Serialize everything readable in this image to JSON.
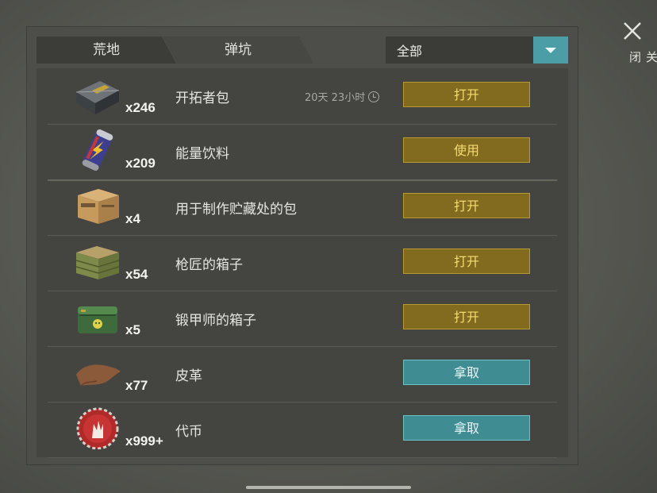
{
  "tabs": [
    {
      "label": "荒地"
    },
    {
      "label": "弹坑"
    }
  ],
  "filter": {
    "selected": "全部"
  },
  "close": {
    "label": "关闭"
  },
  "items": [
    {
      "name": "开拓者包",
      "count": "x246",
      "timer": "20天 23小时",
      "action": "打开",
      "action_style": "gold",
      "icon": "supply-crate-icon"
    },
    {
      "name": "能量饮料",
      "count": "x209",
      "timer": "",
      "action": "使用",
      "action_style": "gold",
      "icon": "energy-drink-icon"
    },
    {
      "name": "用于制作贮藏处的包",
      "count": "x4",
      "timer": "",
      "action": "打开",
      "action_style": "gold",
      "icon": "cardboard-box-icon"
    },
    {
      "name": "枪匠的箱子",
      "count": "x54",
      "timer": "",
      "action": "打开",
      "action_style": "gold",
      "icon": "wooden-crate-icon"
    },
    {
      "name": "锻甲师的箱子",
      "count": "x5",
      "timer": "",
      "action": "打开",
      "action_style": "gold",
      "icon": "military-chest-icon"
    },
    {
      "name": "皮革",
      "count": "x77",
      "timer": "",
      "action": "拿取",
      "action_style": "teal",
      "icon": "leather-icon"
    },
    {
      "name": "代币",
      "count": "x999+",
      "timer": "",
      "action": "拿取",
      "action_style": "teal",
      "icon": "token-cap-icon"
    }
  ],
  "colors": {
    "gold_button": "#826a1f",
    "teal_button": "#3f8c93",
    "panel": "#4d4e4a"
  }
}
